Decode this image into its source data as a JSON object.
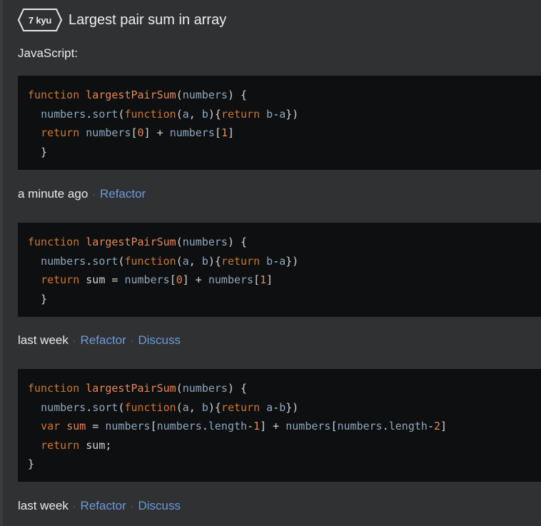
{
  "header": {
    "kyu_badge": "7 kyu",
    "title": "Largest pair sum in array"
  },
  "language_label": "JavaScript:",
  "separator": "·",
  "solutions": [
    {
      "code": [
        [
          [
            "kw",
            "function "
          ],
          [
            "fn",
            "largestPairSum"
          ],
          [
            "op",
            "("
          ],
          [
            "id",
            "numbers"
          ],
          [
            "op",
            ") {"
          ]
        ],
        [
          [
            "op",
            "  "
          ],
          [
            "id",
            "numbers"
          ],
          [
            "op",
            "."
          ],
          [
            "kb",
            "sort"
          ],
          [
            "op",
            "("
          ],
          [
            "kw",
            "function"
          ],
          [
            "op",
            "("
          ],
          [
            "id",
            "a"
          ],
          [
            "op",
            ", "
          ],
          [
            "id",
            "b"
          ],
          [
            "op",
            "){"
          ],
          [
            "kw",
            "return "
          ],
          [
            "id",
            "b"
          ],
          [
            "op",
            "-"
          ],
          [
            "id",
            "a"
          ],
          [
            "op",
            "})"
          ]
        ],
        [
          [
            "op",
            "  "
          ],
          [
            "kw",
            "return "
          ],
          [
            "id",
            "numbers"
          ],
          [
            "op",
            "["
          ],
          [
            "num",
            "0"
          ],
          [
            "op",
            "] + "
          ],
          [
            "id",
            "numbers"
          ],
          [
            "op",
            "["
          ],
          [
            "num",
            "1"
          ],
          [
            "op",
            "]"
          ]
        ],
        [
          [
            "op",
            "  }"
          ]
        ]
      ],
      "time": "a minute ago",
      "links": [
        "Refactor"
      ]
    },
    {
      "code": [
        [
          [
            "kw",
            "function "
          ],
          [
            "fn",
            "largestPairSum"
          ],
          [
            "op",
            "("
          ],
          [
            "id",
            "numbers"
          ],
          [
            "op",
            ") {"
          ]
        ],
        [
          [
            "op",
            "  "
          ],
          [
            "id",
            "numbers"
          ],
          [
            "op",
            "."
          ],
          [
            "kb",
            "sort"
          ],
          [
            "op",
            "("
          ],
          [
            "kw",
            "function"
          ],
          [
            "op",
            "("
          ],
          [
            "id",
            "a"
          ],
          [
            "op",
            ", "
          ],
          [
            "id",
            "b"
          ],
          [
            "op",
            "){"
          ],
          [
            "kw",
            "return "
          ],
          [
            "id",
            "b"
          ],
          [
            "op",
            "-"
          ],
          [
            "id",
            "a"
          ],
          [
            "op",
            "})"
          ]
        ],
        [
          [
            "op",
            "  "
          ],
          [
            "kw",
            "return "
          ],
          [
            "op",
            "sum = "
          ],
          [
            "id",
            "numbers"
          ],
          [
            "op",
            "["
          ],
          [
            "num",
            "0"
          ],
          [
            "op",
            "] + "
          ],
          [
            "id",
            "numbers"
          ],
          [
            "op",
            "["
          ],
          [
            "num",
            "1"
          ],
          [
            "op",
            "]"
          ]
        ],
        [
          [
            "op",
            "  }"
          ]
        ]
      ],
      "time": "last week",
      "links": [
        "Refactor",
        "Discuss"
      ]
    },
    {
      "code": [
        [
          [
            "kw",
            "function "
          ],
          [
            "fn",
            "largestPairSum"
          ],
          [
            "op",
            "("
          ],
          [
            "id",
            "numbers"
          ],
          [
            "op",
            ") {"
          ]
        ],
        [
          [
            "op",
            "  "
          ],
          [
            "id",
            "numbers"
          ],
          [
            "op",
            "."
          ],
          [
            "kb",
            "sort"
          ],
          [
            "op",
            "("
          ],
          [
            "kw",
            "function"
          ],
          [
            "op",
            "("
          ],
          [
            "id",
            "a"
          ],
          [
            "op",
            ", "
          ],
          [
            "id",
            "b"
          ],
          [
            "op",
            "){"
          ],
          [
            "kw",
            "return "
          ],
          [
            "id",
            "a"
          ],
          [
            "op",
            "-"
          ],
          [
            "id",
            "b"
          ],
          [
            "op",
            "})"
          ]
        ],
        [
          [
            "op",
            "  "
          ],
          [
            "kw",
            "var "
          ],
          [
            "fn",
            "sum"
          ],
          [
            "op",
            " = "
          ],
          [
            "id",
            "numbers"
          ],
          [
            "op",
            "["
          ],
          [
            "id",
            "numbers"
          ],
          [
            "op",
            "."
          ],
          [
            "kb",
            "length"
          ],
          [
            "op",
            "-"
          ],
          [
            "num",
            "1"
          ],
          [
            "op",
            "] + "
          ],
          [
            "id",
            "numbers"
          ],
          [
            "op",
            "["
          ],
          [
            "id",
            "numbers"
          ],
          [
            "op",
            "."
          ],
          [
            "kb",
            "length"
          ],
          [
            "op",
            "-"
          ],
          [
            "num",
            "2"
          ],
          [
            "op",
            "]"
          ]
        ],
        [
          [
            "op",
            "  "
          ],
          [
            "kw",
            "return "
          ],
          [
            "op",
            "sum;"
          ]
        ],
        [
          [
            "op",
            "}"
          ]
        ]
      ],
      "time": "last week",
      "links": [
        "Refactor",
        "Discuss"
      ]
    }
  ],
  "colors": {
    "background": "#303133",
    "code_background": "#0e0f10",
    "link": "#6c9ad9",
    "keyword": "#cc7832",
    "function_name": "#e6895a",
    "identifier": "#8fa8c0"
  }
}
